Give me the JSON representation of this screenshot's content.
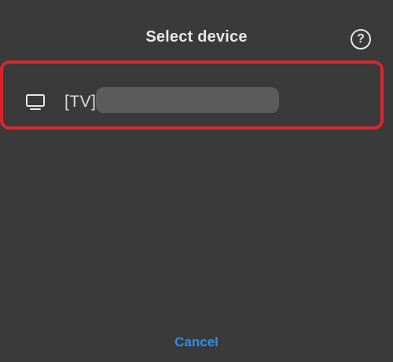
{
  "dialog": {
    "title": "Select device",
    "help_icon": "question-circle-icon",
    "help_glyph": "?",
    "devices": [
      {
        "icon": "tv-icon",
        "name_prefix": "[TV]"
      }
    ],
    "cancel_label": "Cancel"
  },
  "colors": {
    "background": "#3a3a3a",
    "highlight_border": "#d8262f",
    "accent": "#2f8ef0",
    "text": "#e8e8e8"
  }
}
